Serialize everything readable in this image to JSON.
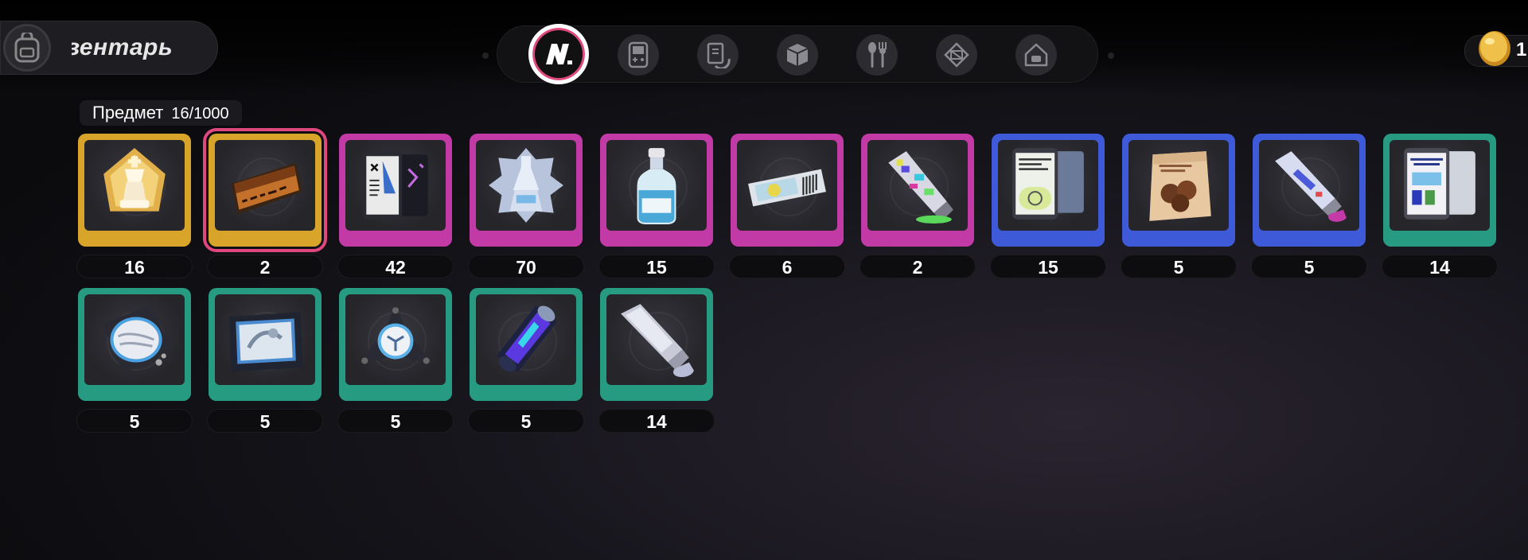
{
  "header": {
    "title": "вентарь",
    "title_icon": "backpack-icon"
  },
  "tabs": [
    {
      "icon": "n-logo-icon",
      "active": true
    },
    {
      "icon": "handheld-console-icon",
      "active": false
    },
    {
      "icon": "card-document-icon",
      "active": false
    },
    {
      "icon": "cube-icon",
      "active": false
    },
    {
      "icon": "fork-spoon-icon",
      "active": false
    },
    {
      "icon": "crystal-box-icon",
      "active": false
    },
    {
      "icon": "home-icon",
      "active": false
    }
  ],
  "currency": {
    "icon": "gold-coin-icon",
    "amount": "1"
  },
  "inventory": {
    "label": "Предмет",
    "count": "16/1000"
  },
  "rarity_colors": {
    "gold": "#d8a42a",
    "purple": "#c23aa6",
    "blue": "#3f5ad8",
    "green": "#279a82"
  },
  "items": [
    {
      "icon": "gold-chess-king-icon",
      "rarity": "gold",
      "qty": "16"
    },
    {
      "icon": "brown-ticket-card-icon",
      "rarity": "gold",
      "qty": "2",
      "selected": true
    },
    {
      "icon": "phone-blueprint-icon",
      "rarity": "purple",
      "qty": "42"
    },
    {
      "icon": "silver-trophy-icon",
      "rarity": "purple",
      "qty": "70"
    },
    {
      "icon": "blue-potion-bottle-icon",
      "rarity": "purple",
      "qty": "15"
    },
    {
      "icon": "ticket-stub-icon",
      "rarity": "purple",
      "qty": "6"
    },
    {
      "icon": "glitch-paint-tube-icon",
      "rarity": "purple",
      "qty": "2"
    },
    {
      "icon": "tablet-document-icon",
      "rarity": "blue",
      "qty": "15"
    },
    {
      "icon": "snack-bag-icon",
      "rarity": "blue",
      "qty": "5"
    },
    {
      "icon": "paint-tube-icon",
      "rarity": "blue",
      "qty": "5"
    },
    {
      "icon": "tablet-poster-icon",
      "rarity": "green",
      "qty": "14"
    },
    {
      "icon": "vinyl-player-icon",
      "rarity": "green",
      "qty": "5"
    },
    {
      "icon": "photo-tablet-icon",
      "rarity": "green",
      "qty": "5"
    },
    {
      "icon": "fidget-spinner-icon",
      "rarity": "green",
      "qty": "5"
    },
    {
      "icon": "energy-capsule-icon",
      "rarity": "green",
      "qty": "5"
    },
    {
      "icon": "silver-paint-tube-icon",
      "rarity": "green",
      "qty": "14"
    }
  ]
}
